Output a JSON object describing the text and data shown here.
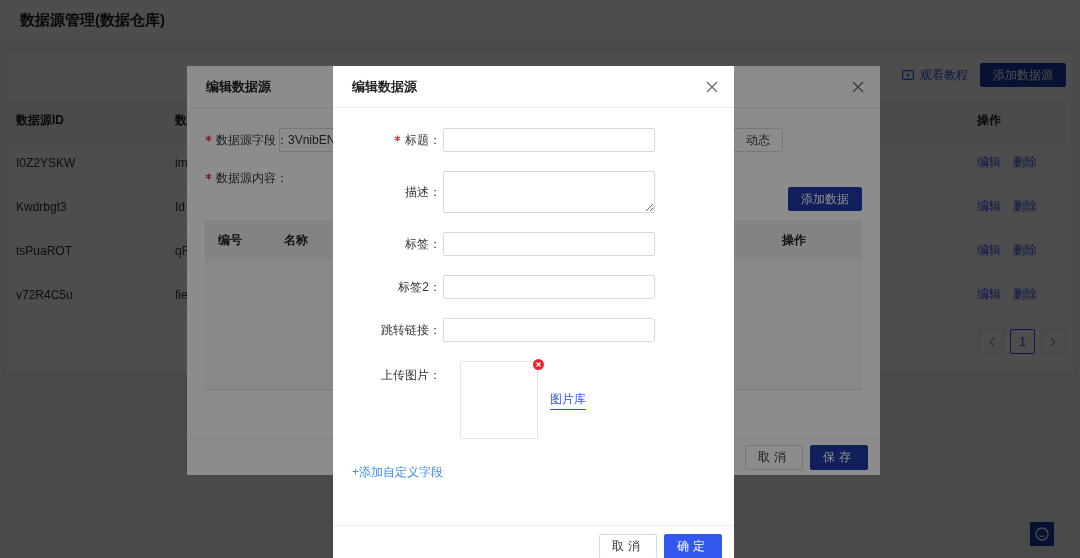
{
  "page": {
    "title": "数据源管理(数据仓库)",
    "tutorial_link": "观看教程",
    "add_button": "添加数据源",
    "table": {
      "columns": [
        "数据源ID",
        "数",
        "操作"
      ],
      "rows": [
        {
          "id": "I0Z2YSKW",
          "column_2": "im",
          "actions": [
            "编辑",
            "删除"
          ]
        },
        {
          "id": "Kwdrbgt3",
          "column_2": "Id",
          "actions": [
            "编辑",
            "删除"
          ]
        },
        {
          "id": "tsPuaROT",
          "column_2": "qF",
          "actions": [
            "编辑",
            "删除"
          ]
        },
        {
          "id": "v72R4C5u",
          "column_2": "fie",
          "actions": [
            "编辑",
            "删除"
          ]
        }
      ]
    },
    "pagination": {
      "pages": [
        {
          "label": "1",
          "selected": true
        }
      ]
    }
  },
  "modal_back": {
    "title": "编辑数据源",
    "fields": [
      {
        "label": "数据源字段：",
        "required": true,
        "value": "3VnibEN"
      },
      {
        "label": "数据源内容：",
        "required": true
      }
    ],
    "mode_button": "动态",
    "add_button": "添加数据",
    "table_columns": [
      "编号",
      "名称",
      "操作"
    ],
    "buttons": [
      {
        "label": "取消",
        "primary": false
      },
      {
        "label": "保存",
        "primary": true
      }
    ]
  },
  "modal_front": {
    "title": "编辑数据源",
    "fields": [
      {
        "label": "标题：",
        "required": true,
        "kind": "input"
      },
      {
        "label": "描述：",
        "required": false,
        "kind": "textarea"
      },
      {
        "label": "标签：",
        "required": false,
        "kind": "input"
      },
      {
        "label": "标签2：",
        "required": false,
        "kind": "input"
      },
      {
        "label": "跳转链接：",
        "required": false,
        "kind": "input"
      },
      {
        "label": "上传图片：",
        "required": false,
        "kind": "upload",
        "library_link": "图片库"
      }
    ],
    "add_field_link": "+添加自定义字段",
    "buttons": [
      {
        "label": "取消",
        "primary": false
      },
      {
        "label": "确定",
        "primary": true
      }
    ]
  }
}
